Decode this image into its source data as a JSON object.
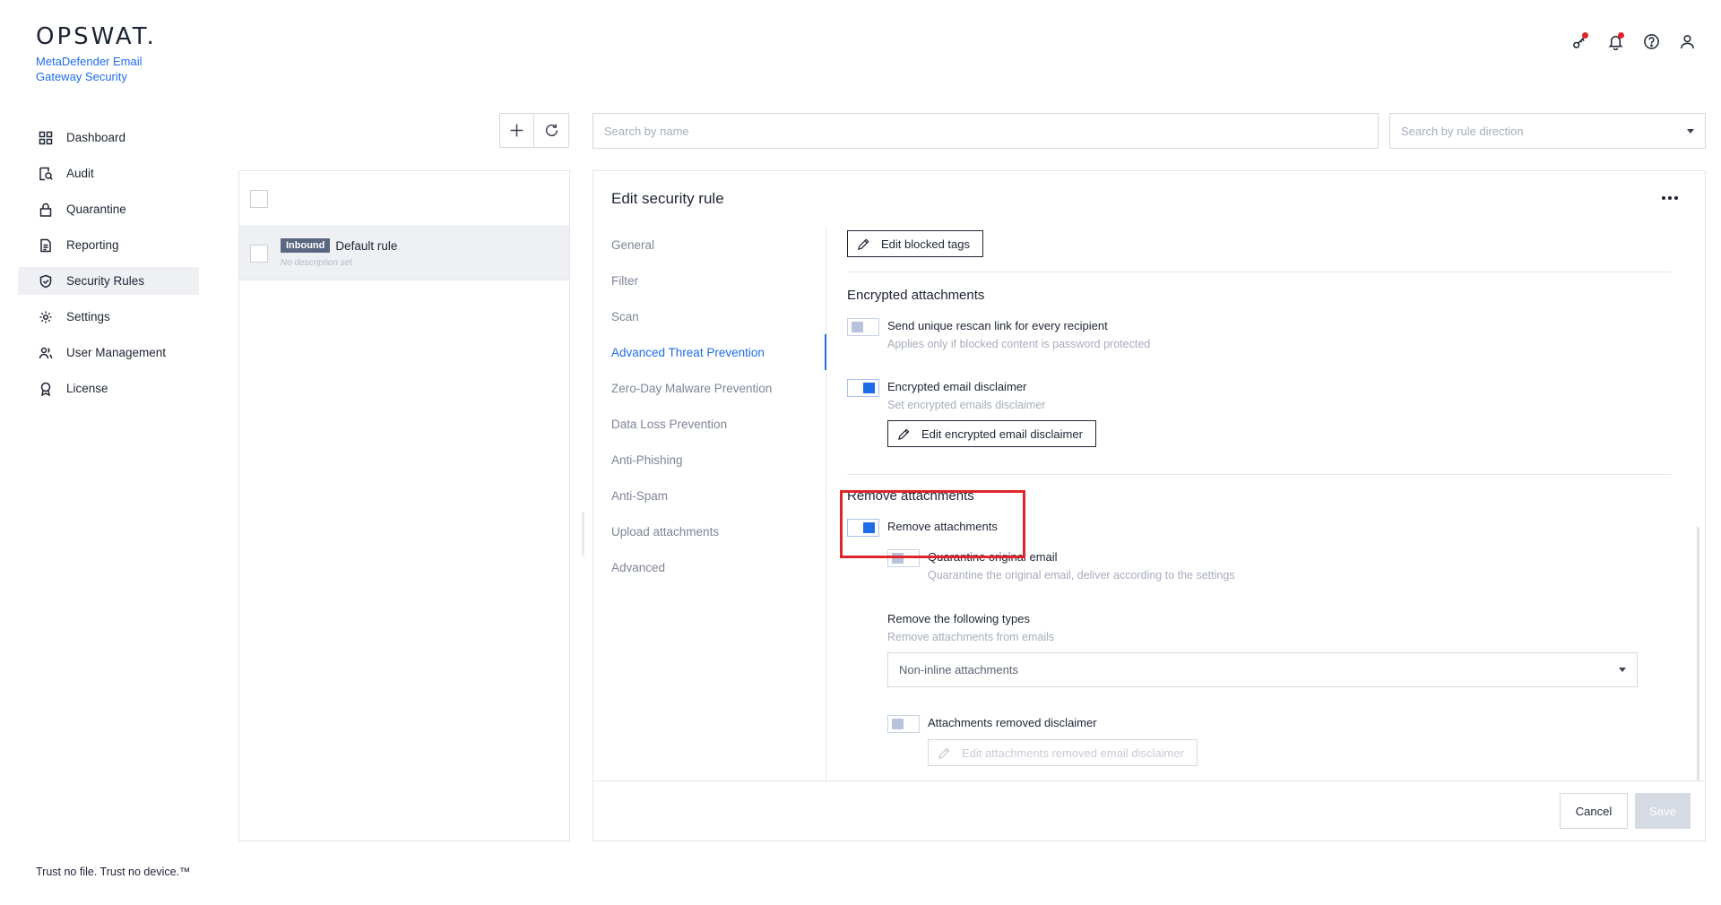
{
  "brand": {
    "logo": "OPSWAT.",
    "product": "MetaDefender Email Gateway Security"
  },
  "nav": {
    "items": [
      {
        "label": "Dashboard",
        "icon": "grid-icon"
      },
      {
        "label": "Audit",
        "icon": "audit-icon"
      },
      {
        "label": "Quarantine",
        "icon": "lock-icon"
      },
      {
        "label": "Reporting",
        "icon": "document-icon"
      },
      {
        "label": "Security Rules",
        "icon": "shield-check-icon",
        "active": true
      },
      {
        "label": "Settings",
        "icon": "gear-icon"
      },
      {
        "label": "User Management",
        "icon": "users-icon"
      },
      {
        "label": "License",
        "icon": "award-icon"
      }
    ]
  },
  "footer": {
    "tagline": "Trust no file. Trust no device.™"
  },
  "topbar": {
    "icons": [
      "key-icon",
      "bell-icon",
      "help-icon",
      "user-icon"
    ],
    "alert_color": "#e0242b"
  },
  "toolbar": {
    "search_name_placeholder": "Search by name",
    "search_direction_placeholder": "Search by rule direction"
  },
  "rules_list": {
    "rows": [
      {
        "direction": "Inbound",
        "name": "Default rule",
        "description": "No description set"
      }
    ]
  },
  "edit": {
    "title": "Edit security rule",
    "tabs": [
      {
        "label": "General"
      },
      {
        "label": "Filter"
      },
      {
        "label": "Scan"
      },
      {
        "label": "Advanced Threat Prevention",
        "active": true
      },
      {
        "label": "Zero-Day Malware Prevention"
      },
      {
        "label": "Data Loss Prevention"
      },
      {
        "label": "Anti-Phishing"
      },
      {
        "label": "Anti-Spam"
      },
      {
        "label": "Upload attachments"
      },
      {
        "label": "Advanced"
      }
    ],
    "edit_blocked_tags_label": "Edit blocked tags",
    "encrypted": {
      "title": "Encrypted attachments",
      "rescan_label": "Send unique rescan link for every recipient",
      "rescan_help": "Applies only if blocked content is password protected",
      "rescan_enabled": false,
      "disclaimer_label": "Encrypted email disclaimer",
      "disclaimer_help": "Set encrypted emails disclaimer",
      "disclaimer_enabled": true,
      "edit_disclaimer_label": "Edit encrypted email disclaimer"
    },
    "remove": {
      "title": "Remove attachments",
      "toggle_label": "Remove attachments",
      "toggle_enabled": true,
      "quarantine_label": "Quarantine original email",
      "quarantine_help": "Quarantine the original email, deliver according to the settings",
      "quarantine_enabled": false,
      "types_label": "Remove the following types",
      "types_help": "Remove attachments from emails",
      "types_value": "Non-inline attachments",
      "removed_disclaimer_label": "Attachments removed disclaimer",
      "removed_disclaimer_enabled": false,
      "edit_removed_disclaimer_label": "Edit attachments removed email disclaimer"
    },
    "cancel_label": "Cancel",
    "save_label": "Save"
  },
  "colors": {
    "accent": "#1d6ce8",
    "highlight": "#e0242b",
    "badge": "#5b6781"
  }
}
